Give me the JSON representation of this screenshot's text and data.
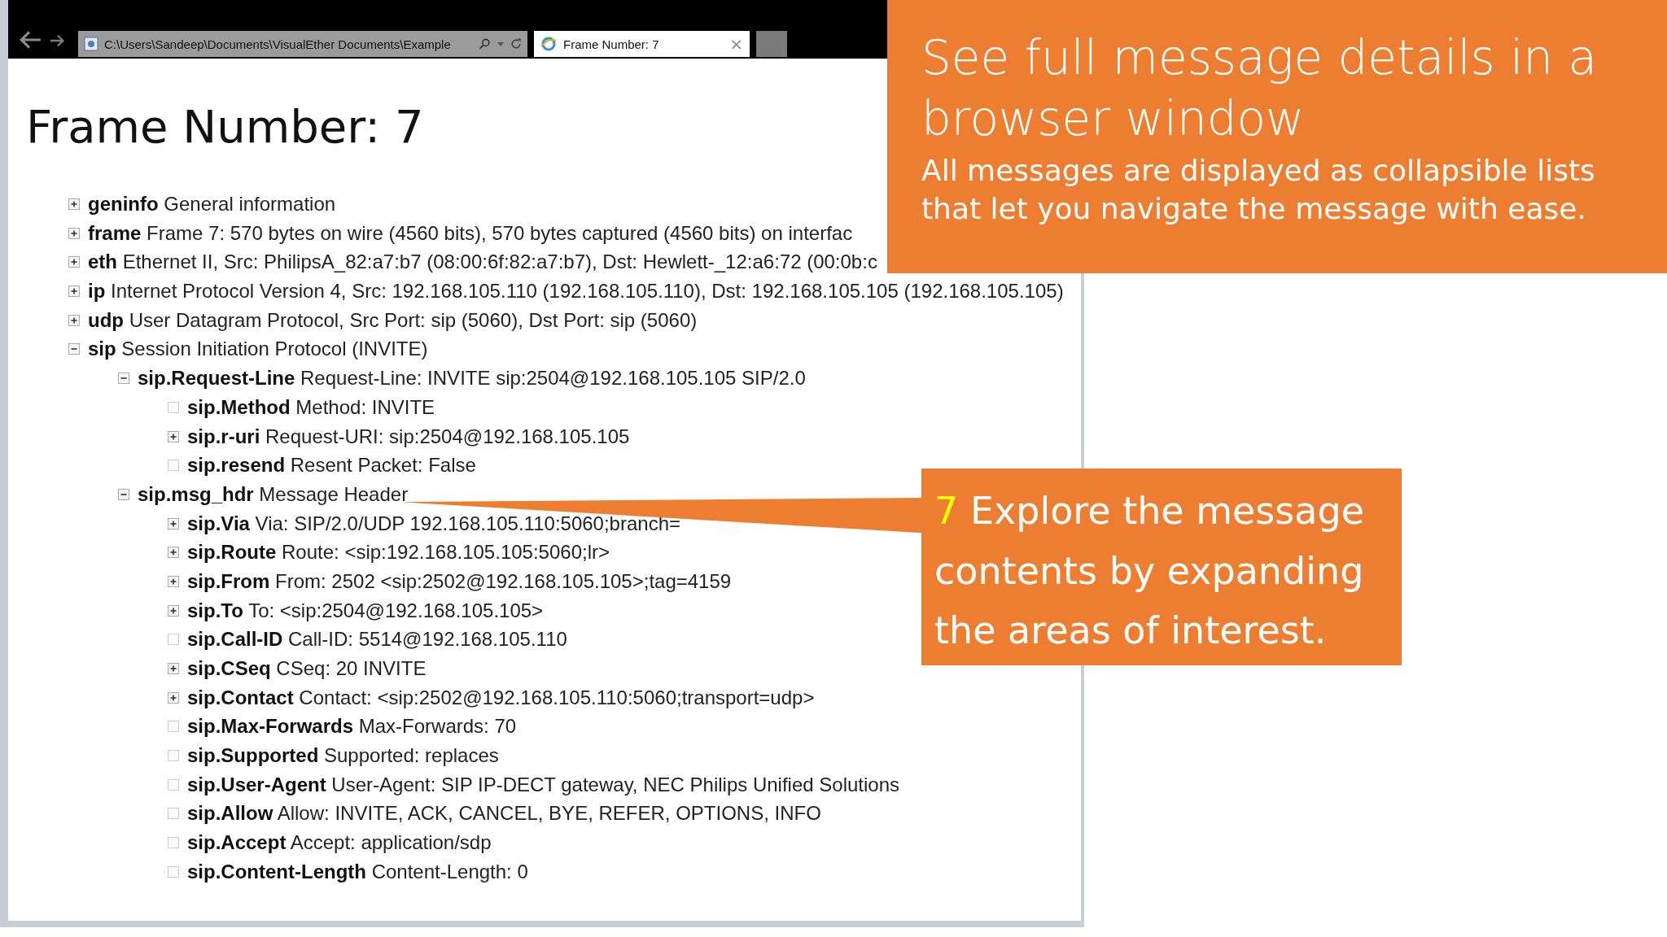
{
  "browser": {
    "address": "C:\\Users\\Sandeep\\Documents\\VisualEther Documents\\Example",
    "tab": {
      "title": "Frame Number: 7",
      "close": "×",
      "selected": true
    }
  },
  "page": {
    "heading": "Frame Number: 7",
    "tree": [
      {
        "kind": "branch",
        "expanded": false,
        "key": "geninfo",
        "value": "General information"
      },
      {
        "kind": "branch",
        "expanded": false,
        "key": "frame",
        "value": "Frame 7: 570 bytes on wire (4560 bits), 570 bytes captured (4560 bits) on interfac"
      },
      {
        "kind": "branch",
        "expanded": false,
        "key": "eth",
        "value": "Ethernet II, Src: PhilipsA_82:a7:b7 (08:00:6f:82:a7:b7), Dst: Hewlett-_12:a6:72 (00:0b:c"
      },
      {
        "kind": "branch",
        "expanded": false,
        "key": "ip",
        "value": "Internet Protocol Version 4, Src: 192.168.105.110 (192.168.105.110), Dst: 192.168.105.105 (192.168.105.105)"
      },
      {
        "kind": "branch",
        "expanded": false,
        "key": "udp",
        "value": "User Datagram Protocol, Src Port: sip (5060), Dst Port: sip (5060)"
      },
      {
        "kind": "branch",
        "expanded": true,
        "key": "sip",
        "value": "Session Initiation Protocol (INVITE)",
        "children": [
          {
            "kind": "branch",
            "expanded": true,
            "key": "sip.Request-Line",
            "value": "Request-Line: INVITE sip:2504@192.168.105.105 SIP/2.0",
            "children": [
              {
                "kind": "leaf",
                "key": "sip.Method",
                "value": "Method: INVITE"
              },
              {
                "kind": "branch",
                "expanded": false,
                "key": "sip.r-uri",
                "value": "Request-URI: sip:2504@192.168.105.105"
              },
              {
                "kind": "leaf",
                "key": "sip.resend",
                "value": "Resent Packet: False"
              }
            ]
          },
          {
            "kind": "branch",
            "expanded": true,
            "key": "sip.msg_hdr",
            "value": "Message Header",
            "children": [
              {
                "kind": "branch",
                "expanded": false,
                "key": "sip.Via",
                "value": "Via: SIP/2.0/UDP 192.168.105.110:5060;branch="
              },
              {
                "kind": "branch",
                "expanded": false,
                "key": "sip.Route",
                "value": "Route: <sip:192.168.105.105:5060;lr>"
              },
              {
                "kind": "branch",
                "expanded": false,
                "key": "sip.From",
                "value": "From: 2502 <sip:2502@192.168.105.105>;tag=4159"
              },
              {
                "kind": "branch",
                "expanded": false,
                "key": "sip.To",
                "value": "To: <sip:2504@192.168.105.105>"
              },
              {
                "kind": "leaf",
                "key": "sip.Call-ID",
                "value": "Call-ID: 5514@192.168.105.110"
              },
              {
                "kind": "branch",
                "expanded": false,
                "key": "sip.CSeq",
                "value": "CSeq: 20 INVITE"
              },
              {
                "kind": "branch",
                "expanded": false,
                "key": "sip.Contact",
                "value": "Contact: <sip:2502@192.168.105.110:5060;transport=udp>"
              },
              {
                "kind": "leaf",
                "key": "sip.Max-Forwards",
                "value": "Max-Forwards: 70"
              },
              {
                "kind": "leaf",
                "key": "sip.Supported",
                "value": "Supported: replaces"
              },
              {
                "kind": "leaf",
                "key": "sip.User-Agent",
                "value": "User-Agent: SIP IP-DECT gateway, NEC Philips Unified Solutions"
              },
              {
                "kind": "leaf",
                "key": "sip.Allow",
                "value": "Allow: INVITE, ACK, CANCEL, BYE, REFER, OPTIONS, INFO"
              },
              {
                "kind": "leaf",
                "key": "sip.Accept",
                "value": "Accept: application/sdp"
              },
              {
                "kind": "leaf",
                "key": "sip.Content-Length",
                "value": "Content-Length: 0"
              }
            ]
          }
        ]
      }
    ]
  },
  "callouts": [
    {
      "title": "See full message details in a browser window",
      "body": "All messages are displayed as collapsible lists that let you navigate the message with ease."
    },
    {
      "number": "7",
      "text": "Explore the message contents by expanding the areas of interest."
    }
  ]
}
